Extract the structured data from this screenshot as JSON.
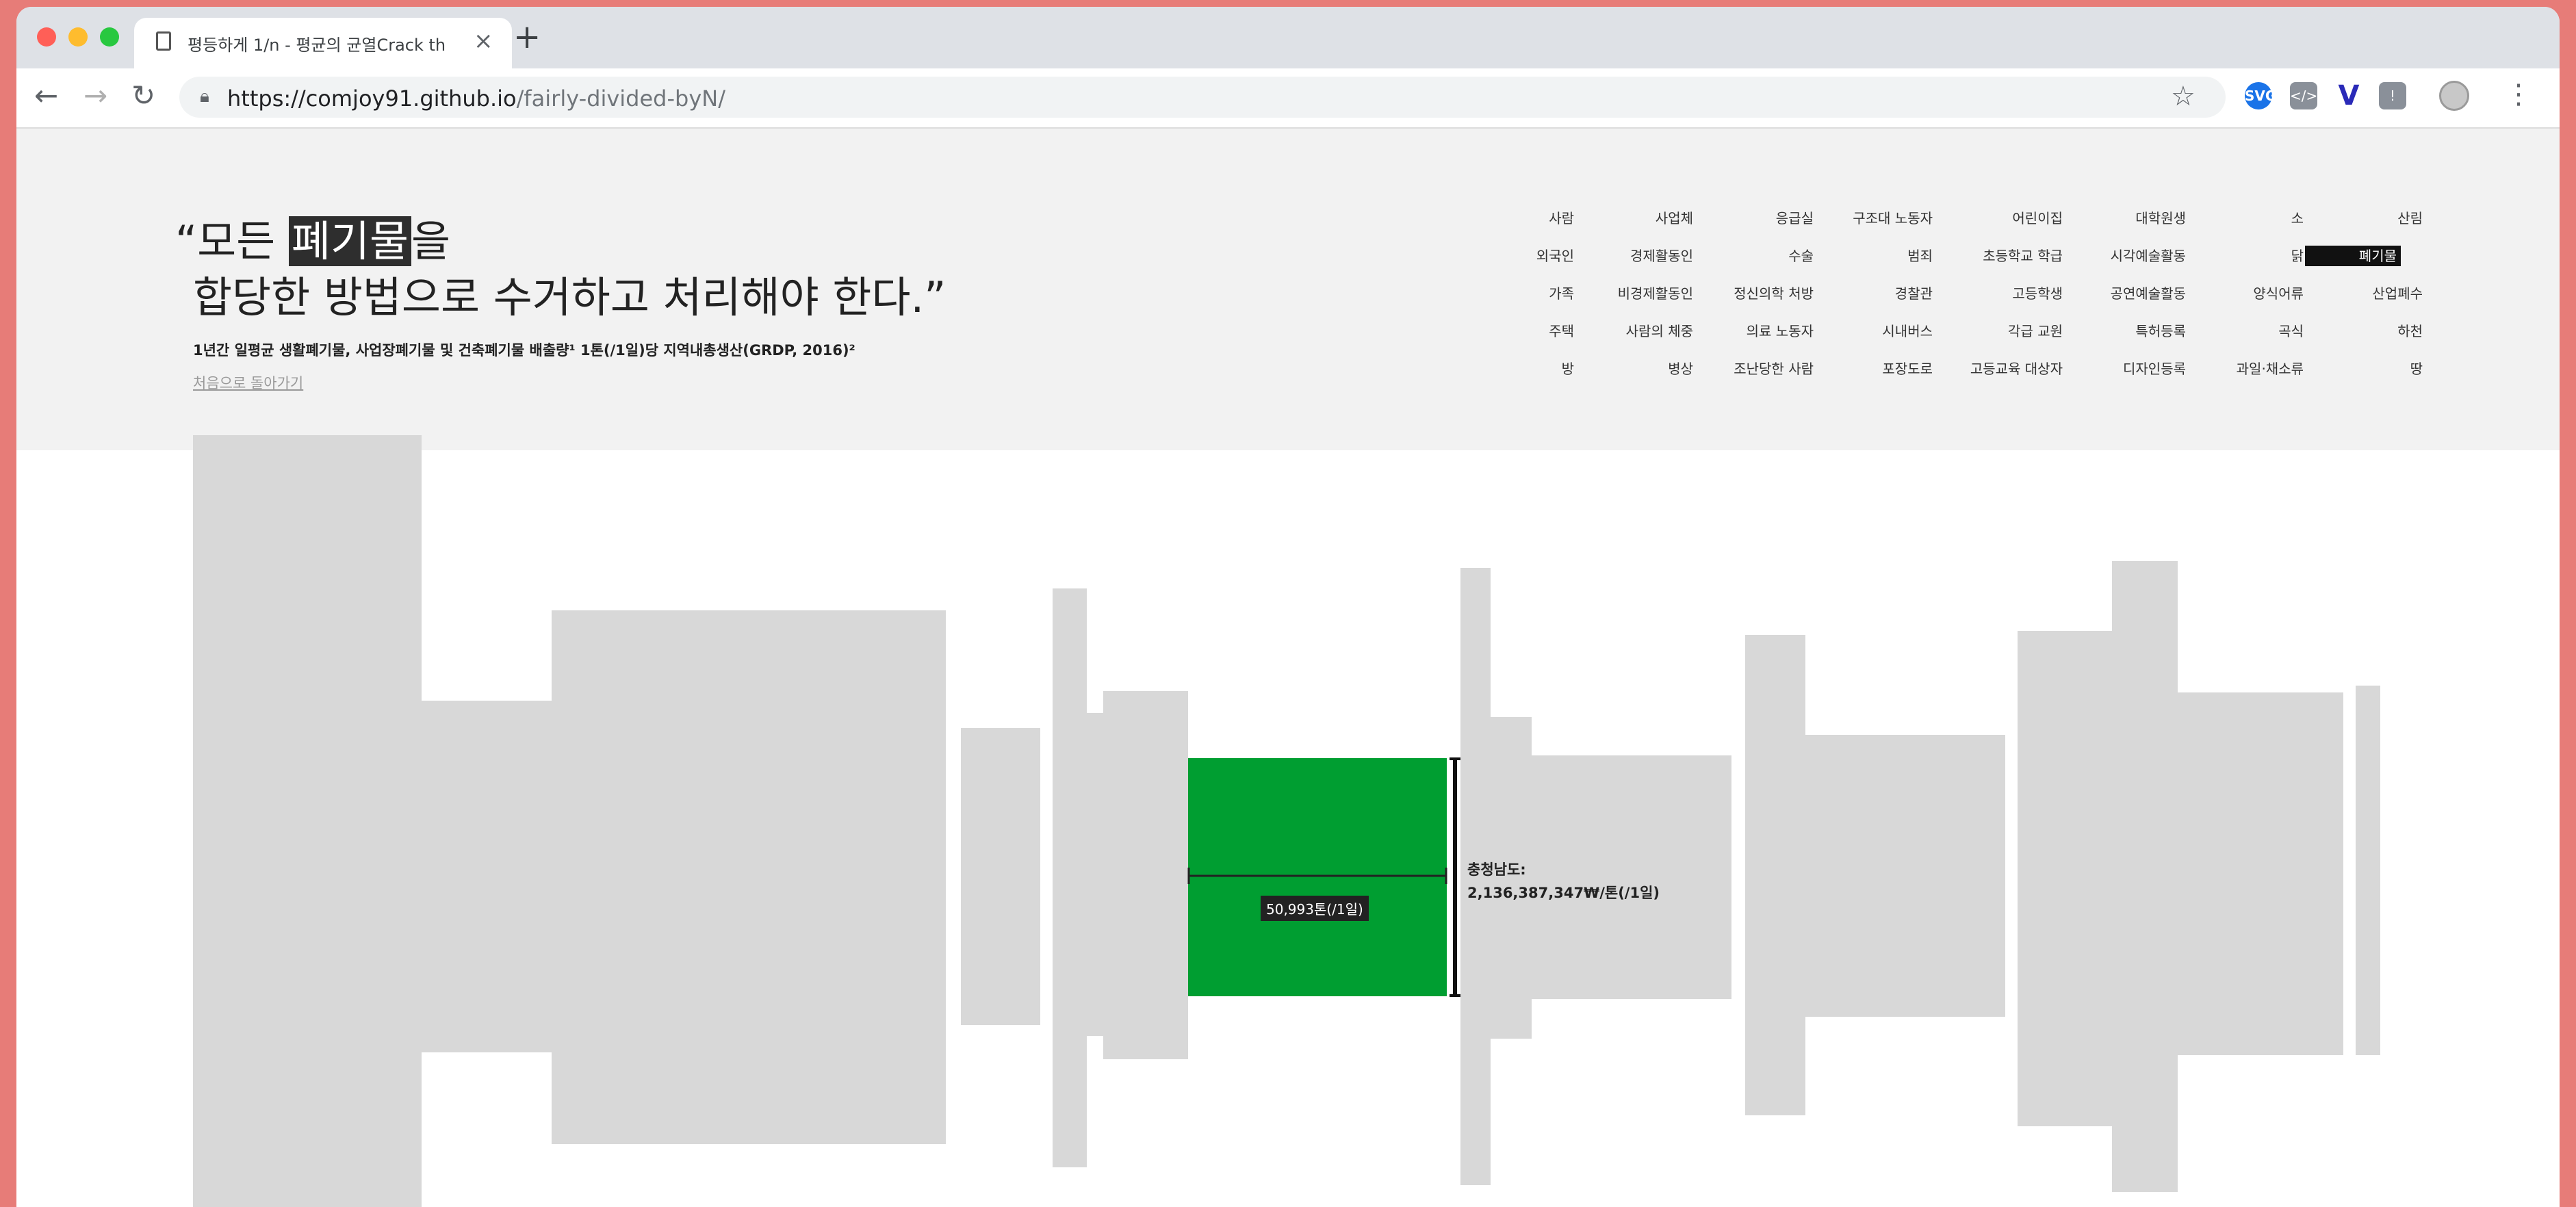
{
  "browser": {
    "tab_title": "평등하게 1/n - 평균의 균열Crack th",
    "new_tab_label": "+",
    "url_host": "https://comjoy91.github.io",
    "url_path": "/fairly-divided-byN/",
    "extensions": [
      "SVG",
      "</>",
      "V",
      "!"
    ]
  },
  "header": {
    "quote_open": "“모든 ",
    "quote_highlight": "폐기물",
    "quote_after": "을",
    "quote_line2": "합당한 방법으로 수거하고 처리해야 한다.”",
    "caption": "1년간 일평균 생활폐기물, 사업장폐기물 및 건축폐기물 배출량¹ 1톤(/1일)당 지역내총생산(GRDP, 2016)²",
    "back_link": "처음으로 돌아가기"
  },
  "categories": [
    [
      "사람",
      "사업체",
      "응급실",
      "구조대 노동자",
      "어린이집",
      "대학원생",
      "소",
      "산림"
    ],
    [
      "외국인",
      "경제활동인",
      "수술",
      "범죄",
      "초등학교 학급",
      "시각예술활동",
      "닭",
      "폐기물"
    ],
    [
      "가족",
      "비경제활동인",
      "정신의학 처방",
      "경찰관",
      "고등학생",
      "공연예술활동",
      "양식어류",
      "산업폐수"
    ],
    [
      "주택",
      "사람의 체중",
      "의료 노동자",
      "시내버스",
      "각급 교원",
      "특허등록",
      "곡식",
      "하천"
    ],
    [
      "방",
      "병상",
      "조난당한 사람",
      "포장도로",
      "고등교육 대상자",
      "디자인등록",
      "과일·채소류",
      "땅"
    ]
  ],
  "active_category": "폐기물",
  "selected": {
    "value_label": "50,993톤(/1일)",
    "region_line1": "충청남도:",
    "region_line2": "2,136,387,347₩/톤(/1일)"
  },
  "colors": {
    "accent_green": "#009e31",
    "segment_gray": "#d8d8d8",
    "band_gray": "#f2f2f2"
  }
}
